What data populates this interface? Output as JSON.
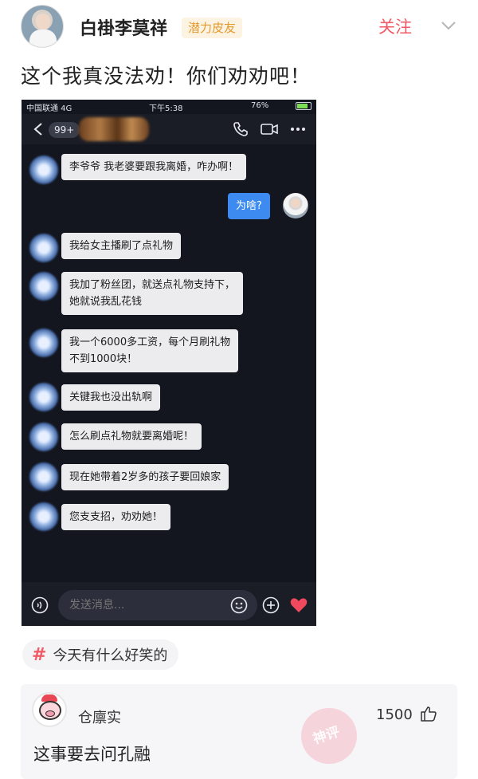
{
  "post": {
    "author_name": "白褂李莫祥",
    "author_badge": "潜力皮友",
    "follow_label": "关注",
    "text": "这个我真没法劝！你们劝劝吧！"
  },
  "screenshot": {
    "status": {
      "carrier": "中国联通 4G",
      "time": "下午5:38",
      "battery": "76%"
    },
    "unread_count": "99+",
    "messages": [
      {
        "side": "left",
        "text": "李爷爷 我老婆要跟我离婚，咋办啊！"
      },
      {
        "side": "right",
        "text": "为啥?"
      },
      {
        "side": "left",
        "text": "我给女主播刷了点礼物"
      },
      {
        "side": "left",
        "text": "我加了粉丝团，就送点礼物支持下，\n她就说我乱花钱"
      },
      {
        "side": "left",
        "text": "我一个6000多工资，每个月刷礼物\n不到1000块！"
      },
      {
        "side": "left",
        "text": "关键我也没出轨啊"
      },
      {
        "side": "left",
        "text": "怎么刷点礼物就要离婚呢！"
      },
      {
        "side": "left",
        "text": "现在她带着2岁多的孩子要回娘家"
      },
      {
        "side": "left",
        "text": "您支支招，劝劝她！"
      }
    ],
    "input_placeholder": "发送消息..."
  },
  "topic": {
    "label": "今天有什么好笑的"
  },
  "comment": {
    "username": "仓廪实",
    "likes": "1500",
    "text": "这事要去问孔融",
    "stamp": "神评"
  },
  "colors": {
    "accent": "#ef5a66",
    "badge_text": "#e39a2e",
    "chat_bg": "#14161f",
    "self_bubble": "#3d8bf0"
  },
  "icons": [
    "chevron-down-icon",
    "back-icon",
    "phone-icon",
    "video-icon",
    "more-icon",
    "voice-icon",
    "emoji-icon",
    "plus-icon",
    "heart-icon",
    "hash-icon",
    "thumbs-up-icon"
  ]
}
